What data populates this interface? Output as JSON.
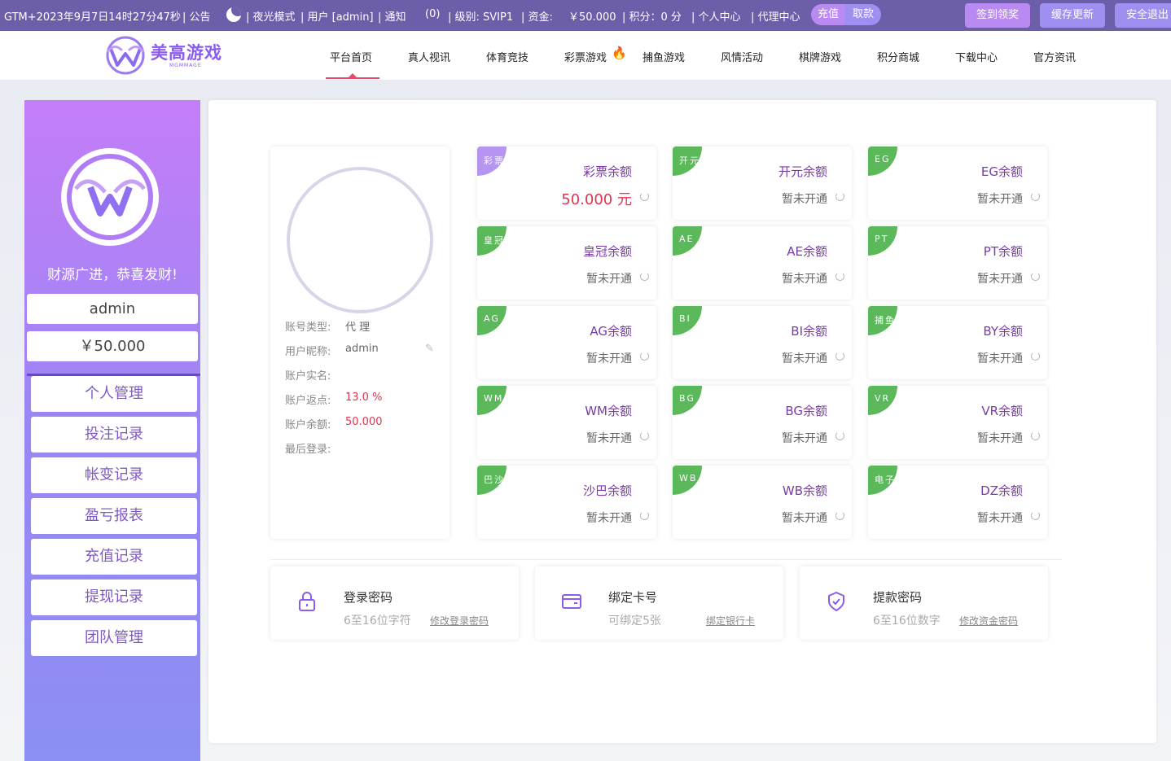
{
  "topbar": {
    "datetime": "GTM+2023年9月7日14时27分47秒",
    "notice": "| 公告",
    "night_mode": "| 夜光模式",
    "user": "| 用户 [admin]",
    "notify": "| 通知",
    "notify_count": "(0)",
    "level": "| 级别: SVIP1",
    "funds_label": "| 资金:",
    "funds_value": "￥50.000",
    "points": "| 积分：0 分",
    "personal": "| 个人中心",
    "agent": "| 代理中心",
    "recharge": "充值",
    "withdraw": "取款",
    "signin": "签到领奖",
    "cache": "缓存更新",
    "logout": "安全退出",
    "colors": {
      "bar": "#6c5ea9",
      "recharge": "#b98af2",
      "withdraw": "#9f8ff0"
    }
  },
  "header": {
    "logo_text": "美高游戏",
    "logo_sub": "MGMMAGE",
    "nav": [
      {
        "label": "平台首页",
        "active": true
      },
      {
        "label": "真人视讯"
      },
      {
        "label": "体育竞技"
      },
      {
        "label": "彩票游戏"
      },
      {
        "label": "捕鱼游戏"
      },
      {
        "label": "风情活动"
      },
      {
        "label": "棋牌游戏"
      },
      {
        "label": "积分商城"
      },
      {
        "label": "下载中心"
      },
      {
        "label": "官方资讯"
      }
    ]
  },
  "sidebar": {
    "slogan": "财源广进，恭喜发财!",
    "username": "admin",
    "balance": "￥50.000",
    "menu": [
      "个人管理",
      "投注记录",
      "帐变记录",
      "盈亏报表",
      "充值记录",
      "提现记录",
      "团队管理"
    ]
  },
  "profile": {
    "rows": [
      {
        "label": "账号类型:",
        "value": "代 理"
      },
      {
        "label": "用户昵称:",
        "value": "admin"
      },
      {
        "label": "账户实名:",
        "value": ""
      },
      {
        "label": "账户返点:",
        "value": "13.0 %"
      },
      {
        "label": "账户余额:",
        "value": "50.000"
      },
      {
        "label": "最后登录:",
        "value": ""
      }
    ]
  },
  "wallets": [
    {
      "tag": "彩票",
      "title": "彩票余额",
      "status": "50.000 元",
      "money": true
    },
    {
      "tag": "开元",
      "title": "开元余额",
      "status": "暂未开通"
    },
    {
      "tag": "EG",
      "title": "EG余额",
      "status": "暂未开通"
    },
    {
      "tag": "皇冠",
      "title": "皇冠余额",
      "status": "暂未开通"
    },
    {
      "tag": "AE",
      "title": "AE余额",
      "status": "暂未开通"
    },
    {
      "tag": "PT",
      "title": "PT余额",
      "status": "暂未开通"
    },
    {
      "tag": "AG",
      "title": "AG余额",
      "status": "暂未开通"
    },
    {
      "tag": "BI",
      "title": "BI余额",
      "status": "暂未开通"
    },
    {
      "tag": "捕鱼",
      "title": "BY余额",
      "status": "暂未开通"
    },
    {
      "tag": "WM",
      "title": "WM余额",
      "status": "暂未开通"
    },
    {
      "tag": "BG",
      "title": "BG余额",
      "status": "暂未开通"
    },
    {
      "tag": "VR",
      "title": "VR余额",
      "status": "暂未开通"
    },
    {
      "tag": "巴沙",
      "title": "沙巴余额",
      "status": "暂未开通"
    },
    {
      "tag": "WB",
      "title": "WB余额",
      "status": "暂未开通"
    },
    {
      "tag": "电子",
      "title": "DZ余额",
      "status": "暂未开通"
    }
  ],
  "security": [
    {
      "title": "登录密码",
      "desc": "6至16位字符",
      "link": "修改登录密码",
      "icon": "lock-icon"
    },
    {
      "title": "绑定卡号",
      "desc": "可绑定5张",
      "link": "绑定银行卡",
      "icon": "card-icon"
    },
    {
      "title": "提款密码",
      "desc": "6至16位数字",
      "link": "修改资金密码",
      "icon": "shield-check-icon"
    }
  ]
}
